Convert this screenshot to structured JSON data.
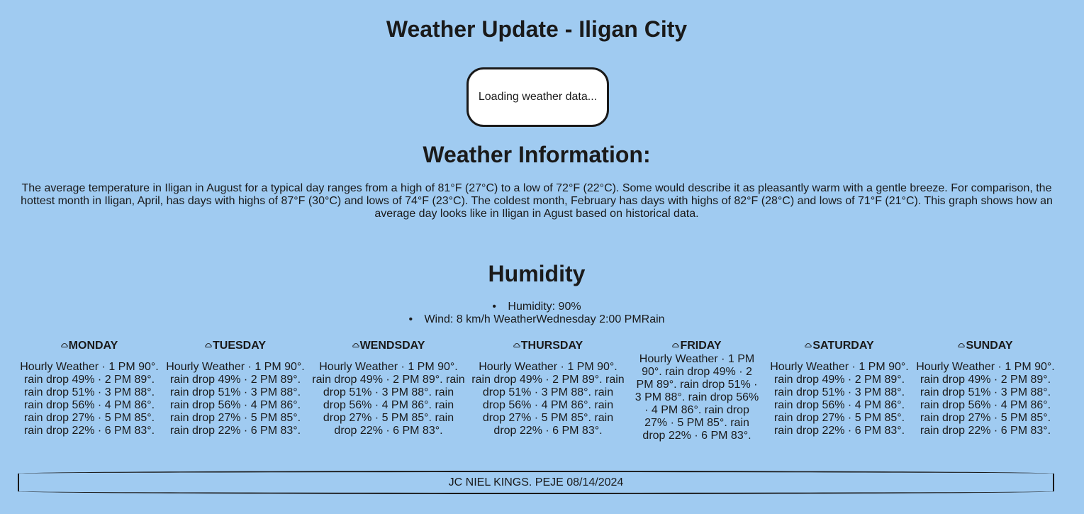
{
  "header": {
    "title": "Weather Update - Iligan City"
  },
  "loading": {
    "text": "Loading weather data..."
  },
  "info": {
    "heading": "Weather Information:",
    "text": "The average temperature in Iligan in August for a typical day ranges from a high of 81°F (27°C) to a low of 72°F (22°C). Some would describe it as pleasantly warm with a gentle breeze. For comparison, the hottest month in Iligan, April, has days with highs of 87°F (30°C) and lows of 74°F (23°C). The coldest month, February has days with highs of 82°F (28°C) and lows of 71°F (21°C). This graph shows how an average day looks like in Iligan in Agust based on historical data."
  },
  "humidity": {
    "heading": "Humidity",
    "items": [
      "Humidity: 90%",
      "Wind: 8 km/h WeatherWednesday 2:00 PMRain"
    ]
  },
  "days": [
    {
      "name": "MONDAY",
      "icon": "cloud-icon",
      "text": "Hourly Weather · 1 PM 90°. rain drop 49% · 2 PM 89°. rain drop 51% · 3 PM 88°. rain drop 56% · 4 PM 86°. rain drop 27% · 5 PM 85°. rain drop 22% · 6 PM 83°."
    },
    {
      "name": "TUESDAY",
      "icon": "cloud-icon",
      "text": "Hourly Weather · 1 PM 90°. rain drop 49% · 2 PM 89°. rain drop 51% · 3 PM 88°. rain drop 56% · 4 PM 86°. rain drop 27% · 5 PM 85°. rain drop 22% · 6 PM 83°."
    },
    {
      "name": "WENDSDAY",
      "icon": "cloud-icon",
      "text": "Hourly Weather · 1 PM 90°. rain drop 49% · 2 PM 89°. rain drop 51% · 3 PM 88°. rain drop 56% · 4 PM 86°. rain drop 27% · 5 PM 85°. rain drop 22% · 6 PM 83°."
    },
    {
      "name": "THURSDAY",
      "icon": "cloud-icon",
      "text": "Hourly Weather · 1 PM 90°. rain drop 49% · 2 PM 89°. rain drop 51% · 3 PM 88°. rain drop 56% · 4 PM 86°. rain drop 27% · 5 PM 85°. rain drop 22% · 6 PM 83°."
    },
    {
      "name": "FRIDAY",
      "icon": "cloud-icon",
      "text": "Hourly Weather · 1 PM 90°. rain drop 49% · 2 PM 89°. rain drop 51% · 3 PM 88°. rain drop 56% · 4 PM 86°. rain drop 27% · 5 PM 85°. rain drop 22% · 6 PM 83°."
    },
    {
      "name": "SATURDAY",
      "icon": "cloud-icon",
      "text": "Hourly Weather · 1 PM 90°. rain drop 49% · 2 PM 89°. rain drop 51% · 3 PM 88°. rain drop 56% · 4 PM 86°. rain drop 27% · 5 PM 85°. rain drop 22% · 6 PM 83°."
    },
    {
      "name": "SUNDAY",
      "icon": "cloud-icon",
      "text": "Hourly Weather · 1 PM 90°. rain drop 49% · 2 PM 89°. rain drop 51% · 3 PM 88°. rain drop 56% · 4 PM 86°. rain drop 27% · 5 PM 85°. rain drop 22% · 6 PM 83°."
    }
  ],
  "footer": {
    "text": "JC NIEL KINGS. PEJE 08/14/2024"
  },
  "colors": {
    "background": "#a0cbf1",
    "loading_box": "#ffffff",
    "text": "#1a1a1a"
  }
}
